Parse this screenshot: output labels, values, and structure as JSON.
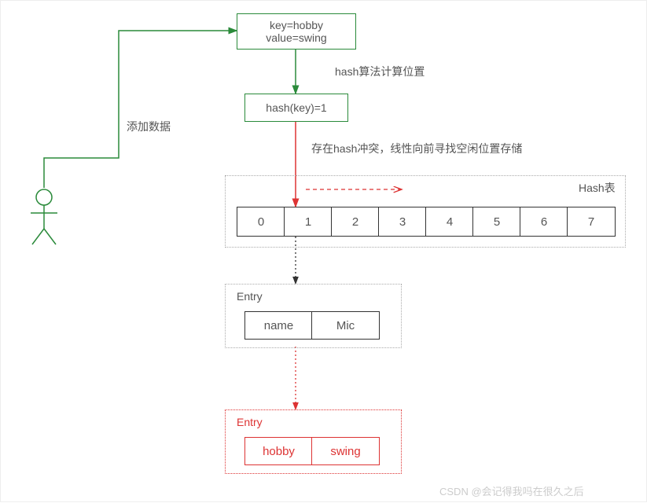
{
  "input": {
    "line1": "key=hobby",
    "line2": "value=swing"
  },
  "step1_label": "hash算法计算位置",
  "hashbox": "hash(key)=1",
  "add_label": "添加数据",
  "conflict_label": "存在hash冲突，线性向前寻找空闲位置存储",
  "hashtable_title": "Hash表",
  "cells": [
    "0",
    "1",
    "2",
    "3",
    "4",
    "5",
    "6",
    "7"
  ],
  "entry1": {
    "title": "Entry",
    "k": "name",
    "v": "Mic"
  },
  "entry2": {
    "title": "Entry",
    "k": "hobby",
    "v": "swing"
  },
  "watermark": "CSDN @会记得我吗在很久之后"
}
